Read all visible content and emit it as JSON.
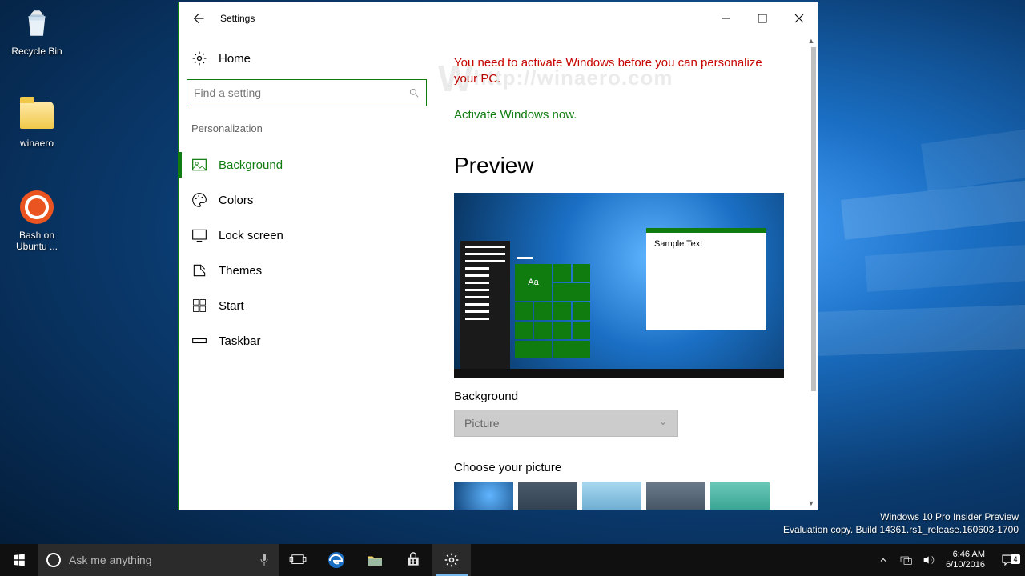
{
  "desktop": {
    "icons": [
      {
        "label": "Recycle Bin"
      },
      {
        "label": "winaero"
      },
      {
        "label": "Bash on Ubuntu ..."
      }
    ]
  },
  "window": {
    "title": "Settings",
    "home": "Home",
    "search_placeholder": "Find a setting",
    "section": "Personalization",
    "nav": [
      {
        "label": "Background"
      },
      {
        "label": "Colors"
      },
      {
        "label": "Lock screen"
      },
      {
        "label": "Themes"
      },
      {
        "label": "Start"
      },
      {
        "label": "Taskbar"
      }
    ],
    "warning": "You need to activate Windows before you can personalize your PC.",
    "activate_link": "Activate Windows now.",
    "watermark": "http://winaero.com",
    "preview_heading": "Preview",
    "sample_text": "Sample Text",
    "aa": "Aa",
    "bg_label": "Background",
    "bg_value": "Picture",
    "choose_label": "Choose your picture"
  },
  "overlay": {
    "line1": "Windows 10 Pro Insider Preview",
    "line2": "Evaluation copy. Build 14361.rs1_release.160603-1700"
  },
  "taskbar": {
    "cortana_placeholder": "Ask me anything",
    "time": "6:46 AM",
    "date": "6/10/2016",
    "notif_count": "4"
  }
}
